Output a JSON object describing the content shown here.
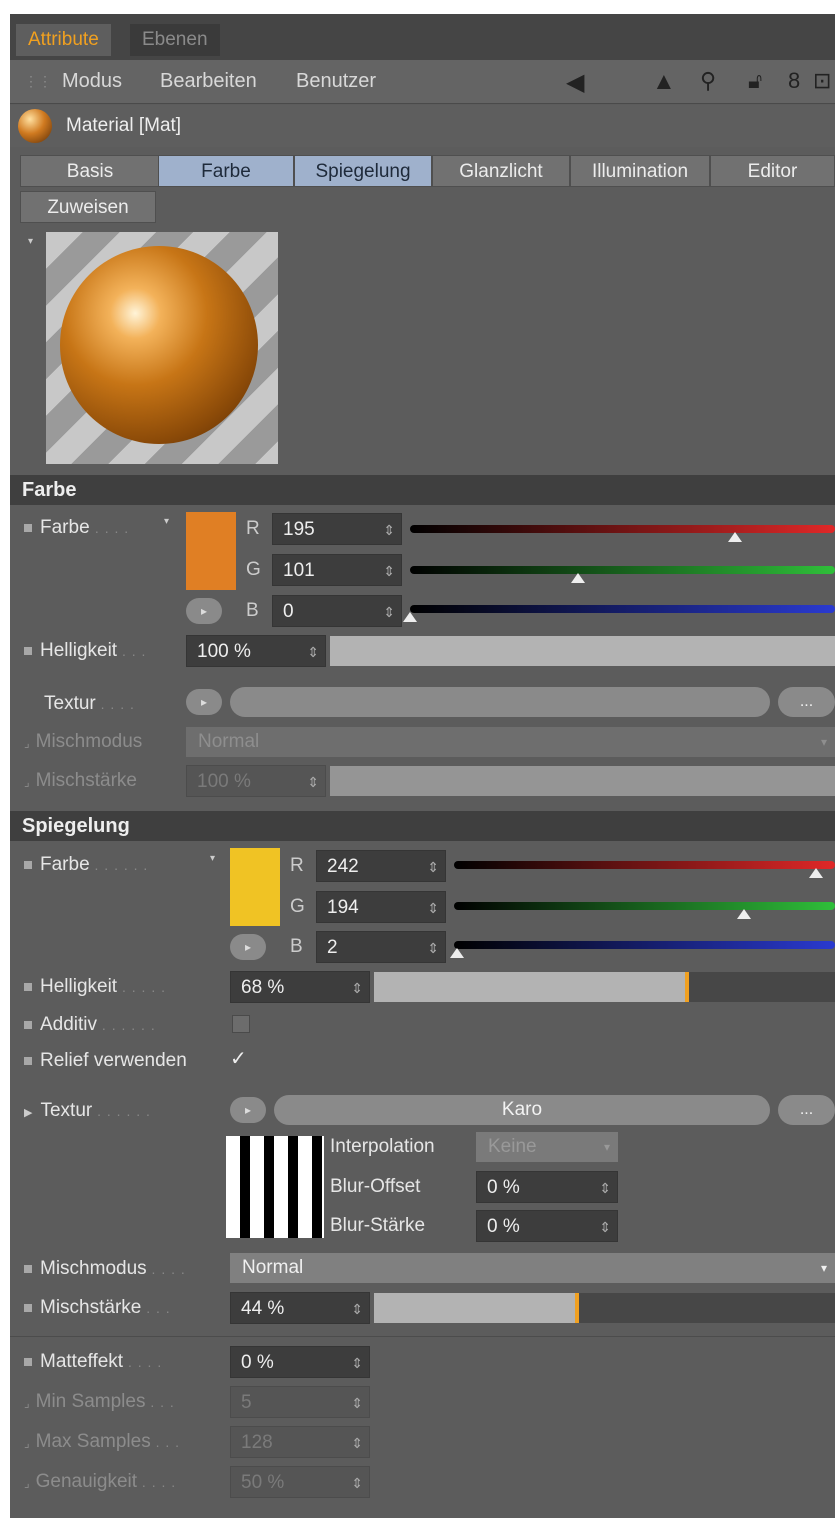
{
  "tabs": [
    {
      "label": "Attribute"
    },
    {
      "label": "Ebenen"
    }
  ],
  "menu": [
    {
      "label": "Modus"
    },
    {
      "label": "Bearbeiten"
    },
    {
      "label": "Benutzer"
    }
  ],
  "material_title": "Material [Mat]",
  "prop_tabs": [
    {
      "label": "Basis"
    },
    {
      "label": "Farbe"
    },
    {
      "label": "Spiegelung"
    },
    {
      "label": "Glanzlicht"
    },
    {
      "label": "Illumination"
    },
    {
      "label": "Editor"
    },
    {
      "label": "Zuweisen"
    }
  ],
  "farbe": {
    "title": "Farbe",
    "color_label": "Farbe",
    "swatch": "#e07f24",
    "r_label": "R",
    "g_label": "G",
    "b_label": "B",
    "r": "195",
    "g": "101",
    "b": "0",
    "r_level": 0.765,
    "g_level": 0.396,
    "b_level": 0.0,
    "brightness_label": "Helligkeit",
    "brightness": "100 %",
    "brightness_level": 1.0,
    "texture_label": "Textur",
    "texture_more": "...",
    "mix_mode_label": "Mischmodus",
    "mix_mode": "Normal",
    "mix_strength_label": "Mischstärke",
    "mix_strength": "100 %",
    "mix_strength_level": 1.0
  },
  "spiegelung": {
    "title": "Spiegelung",
    "color_label": "Farbe",
    "swatch": "#f0c324",
    "r_label": "R",
    "g_label": "G",
    "b_label": "B",
    "r": "242",
    "g": "194",
    "b": "2",
    "r_level": 0.949,
    "g_level": 0.761,
    "b_level": 0.008,
    "brightness_label": "Helligkeit",
    "brightness": "68 %",
    "brightness_level": 0.68,
    "additive_label": "Additiv",
    "relief_label": "Relief verwenden",
    "relief_checked": "✓",
    "texture_label": "Textur",
    "texture_name": "Karo",
    "texture_more": "...",
    "interpolation_label": "Interpolation",
    "interpolation_value": "Keine",
    "blur_offset_label": "Blur-Offset",
    "blur_offset": "0 %",
    "blur_strength_label": "Blur-Stärke",
    "blur_strength": "0 %",
    "mix_mode_label": "Mischmodus",
    "mix_mode": "Normal",
    "mix_strength_label": "Mischstärke",
    "mix_strength": "44 %",
    "mix_strength_level": 0.44,
    "matte_label": "Matteffekt",
    "matte": "0 %",
    "min_samples_label": "Min Samples",
    "min_samples": "5",
    "max_samples_label": "Max Samples",
    "max_samples": "128",
    "accuracy_label": "Genauigkeit",
    "accuracy": "50 %"
  },
  "colors": {
    "accent": "#f0a020",
    "active_tab": "#9fb1cc",
    "panel": "#5c5c5c",
    "header": "#3f3f3f"
  }
}
